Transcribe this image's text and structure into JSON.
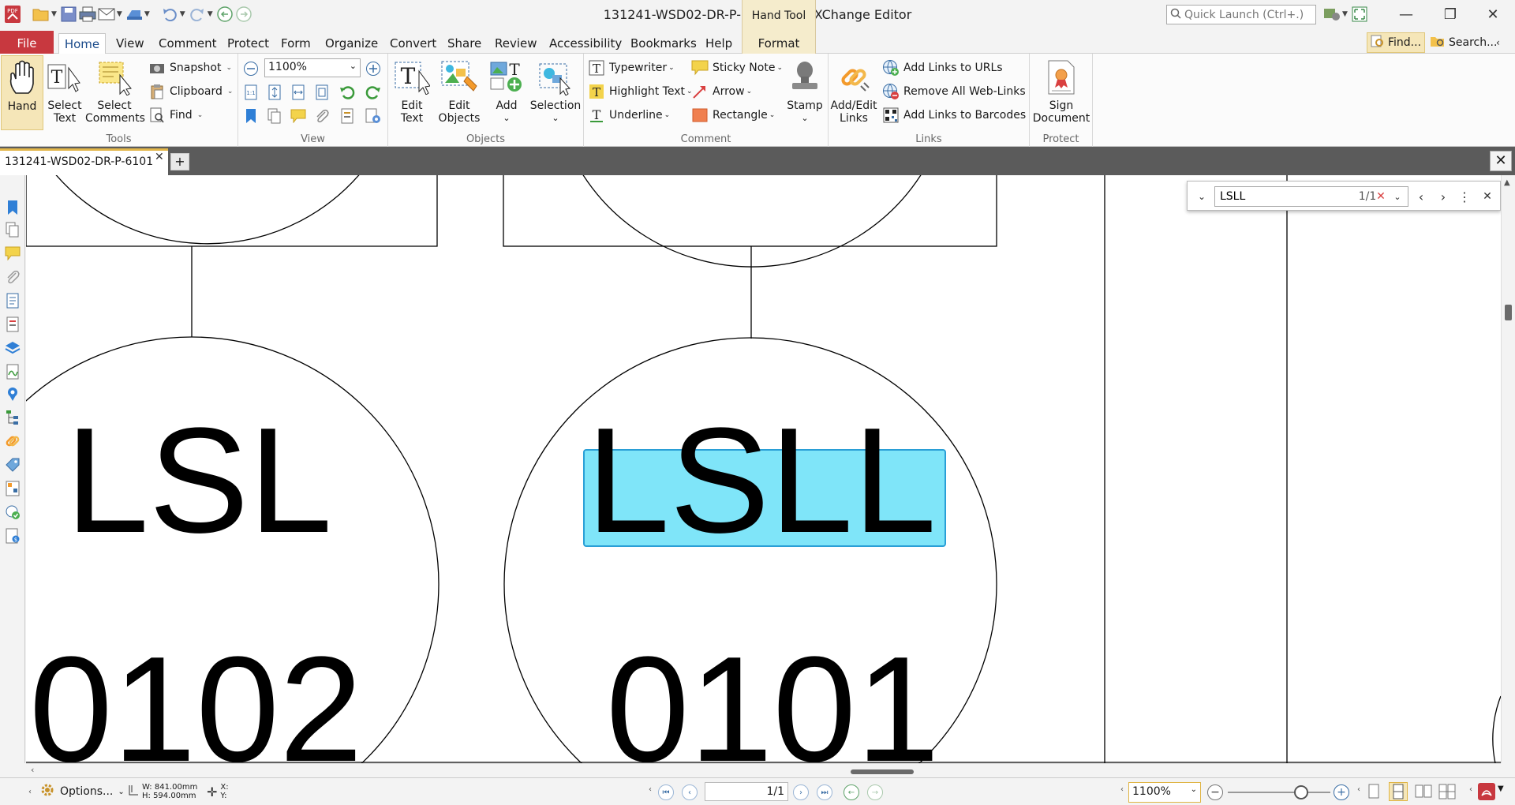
{
  "window": {
    "title": "131241-WSD02-DR-P-6101 - PDF-XChange Editor",
    "context_tool_title": "Hand Tool",
    "quick_launch_placeholder": "Quick Launch (Ctrl+.)"
  },
  "menu": {
    "file": "File",
    "tabs": [
      "Home",
      "View",
      "Comment",
      "Protect",
      "Form",
      "Organize",
      "Convert",
      "Share",
      "Review",
      "Accessibility",
      "Bookmarks",
      "Help"
    ],
    "format": "Format",
    "find": "Find...",
    "search": "Search..."
  },
  "ribbon": {
    "tools": {
      "label": "Tools",
      "hand": "Hand",
      "select_text_1": "Select",
      "select_text_2": "Text",
      "select_comments_1": "Select",
      "select_comments_2": "Comments",
      "snapshot": "Snapshot",
      "clipboard": "Clipboard",
      "find": "Find"
    },
    "view": {
      "label": "View",
      "zoom": "1100%"
    },
    "objects": {
      "label": "Objects",
      "edit_text_1": "Edit",
      "edit_text_2": "Text",
      "edit_objects_1": "Edit",
      "edit_objects_2": "Objects",
      "add": "Add",
      "selection": "Selection"
    },
    "comment": {
      "label": "Comment",
      "typewriter": "Typewriter",
      "highlight_text": "Highlight Text",
      "underline": "Underline",
      "sticky_note": "Sticky Note",
      "arrow": "Arrow",
      "rectangle": "Rectangle",
      "stamp": "Stamp"
    },
    "links": {
      "label": "Links",
      "add_edit_1": "Add/Edit",
      "add_edit_2": "Links",
      "add_links_urls": "Add Links to URLs",
      "remove_web_links": "Remove All Web-Links",
      "add_links_barcodes": "Add Links to Barcodes"
    },
    "protect": {
      "label": "Protect",
      "sign_1": "Sign",
      "sign_2": "Document"
    }
  },
  "document": {
    "tab_name": "131241-WSD02-DR-P-6101",
    "labels": [
      {
        "top": "LSL",
        "bottom": "0102"
      },
      {
        "top": "LSLL",
        "bottom": "0101"
      }
    ]
  },
  "findbar": {
    "query": "LSLL",
    "count": "1/1"
  },
  "status": {
    "options": "Options...",
    "width": "W: 841.00mm",
    "height": "H: 594.00mm",
    "x": "X:",
    "y": "Y:",
    "page": "1/1",
    "zoom": "1100%"
  },
  "colors": {
    "file_tab": "#c8383f",
    "context_tab": "#f5eccc",
    "search_highlight": "#7fe5f9",
    "search_highlight_border": "#2a9fd6",
    "doc_tab_accent": "#e2b64a"
  }
}
